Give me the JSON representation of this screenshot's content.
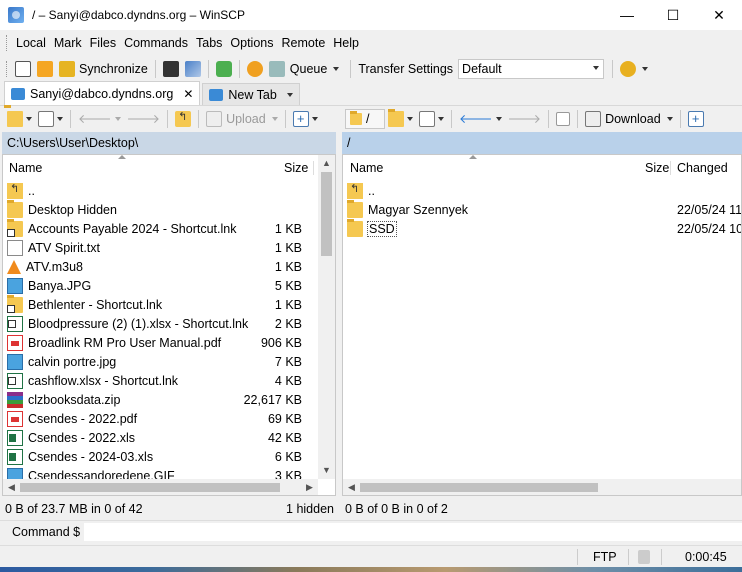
{
  "window": {
    "title": "/ – Sanyi@dabco.dyndns.org – WinSCP",
    "minimize": "—",
    "maximize": "☐",
    "close": "✕"
  },
  "menu": [
    "Local",
    "Mark",
    "Files",
    "Commands",
    "Tabs",
    "Options",
    "Remote",
    "Help"
  ],
  "toolbar": {
    "synchronize": "Synchronize",
    "queue": "Queue",
    "transfer_settings_label": "Transfer Settings",
    "transfer_settings_value": "Default"
  },
  "tabs": [
    {
      "label": "Sanyi@dabco.dyndns.org",
      "close": "✕"
    },
    {
      "label": "New Tab"
    }
  ],
  "left_panel": {
    "upload": "Upload",
    "path": "C:\\Users\\User\\Desktop\\",
    "columns": {
      "name": "Name",
      "size": "Size"
    },
    "files": [
      {
        "name": "..",
        "size": "",
        "icon": "up"
      },
      {
        "name": "Desktop Hidden",
        "size": "",
        "icon": "folder"
      },
      {
        "name": "Accounts Payable 2024 - Shortcut.lnk",
        "size": "1 KB",
        "icon": "folder-shortcut"
      },
      {
        "name": "ATV Spirit.txt",
        "size": "1 KB",
        "icon": "doc"
      },
      {
        "name": "ATV.m3u8",
        "size": "1 KB",
        "icon": "vlc"
      },
      {
        "name": "Banya.JPG",
        "size": "5 KB",
        "icon": "img"
      },
      {
        "name": "Bethlenter - Shortcut.lnk",
        "size": "1 KB",
        "icon": "folder-shortcut"
      },
      {
        "name": "Bloodpressure (2) (1).xlsx - Shortcut.lnk",
        "size": "2 KB",
        "icon": "xls-shortcut"
      },
      {
        "name": "Broadlink RM Pro User Manual.pdf",
        "size": "906 KB",
        "icon": "pdf"
      },
      {
        "name": "calvin portre.jpg",
        "size": "7 KB",
        "icon": "img"
      },
      {
        "name": "cashflow.xlsx - Shortcut.lnk",
        "size": "4 KB",
        "icon": "xls-shortcut"
      },
      {
        "name": "clzbooksdata.zip",
        "size": "22,617 KB",
        "icon": "zip"
      },
      {
        "name": "Csendes - 2022.pdf",
        "size": "69 KB",
        "icon": "pdf"
      },
      {
        "name": "Csendes - 2022.xls",
        "size": "42 KB",
        "icon": "xls"
      },
      {
        "name": "Csendes - 2024-03.xls",
        "size": "6 KB",
        "icon": "xls"
      },
      {
        "name": "Csendessandoredene.GIF",
        "size": "3 KB",
        "icon": "img"
      }
    ],
    "status_selected": "0 B of 23.7 MB in 0 of 42",
    "status_hidden": "1 hidden"
  },
  "right_panel": {
    "path_combo": "/",
    "download": "Download",
    "path": "/",
    "columns": {
      "name": "Name",
      "size": "Size",
      "changed": "Changed"
    },
    "files": [
      {
        "name": "..",
        "changed": "",
        "icon": "up"
      },
      {
        "name": "Magyar Szennyek",
        "changed": "22/05/24 11:",
        "icon": "folder"
      },
      {
        "name": "SSD",
        "changed": "22/05/24 10:",
        "icon": "folder"
      }
    ],
    "status_selected": "0 B of 0 B in 0 of 2"
  },
  "command": {
    "label": "Command $",
    "value": ""
  },
  "statusbar": {
    "protocol": "FTP",
    "elapsed": "0:00:45"
  },
  "colors": {
    "path_bar_active": "#b9d1ea",
    "path_bar_inactive": "#c9d7e6",
    "title_bg": "#ffffff"
  }
}
